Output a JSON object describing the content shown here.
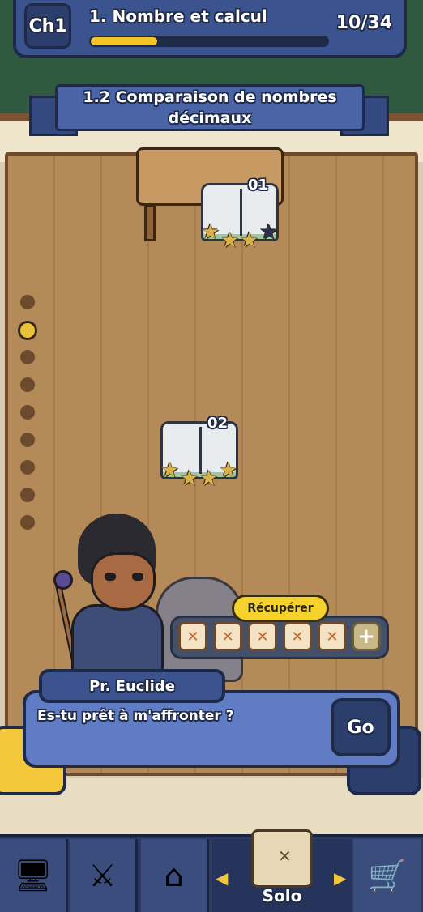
{
  "header": {
    "chapter_badge": "Ch1",
    "chapter_title": "1. Nombre et calcul",
    "progress_fraction": 0.29,
    "progress_count": "10/34"
  },
  "section": {
    "title_line1": "1.2 Comparaison de nombres",
    "title_line2": "décimaux"
  },
  "levels": [
    {
      "number": "01",
      "stars_earned": 2,
      "stars_total": 3
    },
    {
      "number": "02",
      "stars_earned": 3,
      "stars_total": 3
    }
  ],
  "page_dots": {
    "count": 9,
    "active_index": 1
  },
  "recover": {
    "button_label": "Récupérer",
    "map_slots": 5,
    "plus_icon": "plus-icon"
  },
  "dialog": {
    "speaker": "Pr. Euclide",
    "text": "Es-tu prêt à m'affronter ?",
    "go_label": "Go"
  },
  "bottom_nav": {
    "items": [
      "computer-icon",
      "crossed-swords-icon",
      "home-icon",
      "map-icon",
      "cart-icon"
    ],
    "active_label": "Solo"
  },
  "colors": {
    "accent": "#3b5490",
    "gold": "#f3c83a",
    "floor": "#b58a59"
  }
}
